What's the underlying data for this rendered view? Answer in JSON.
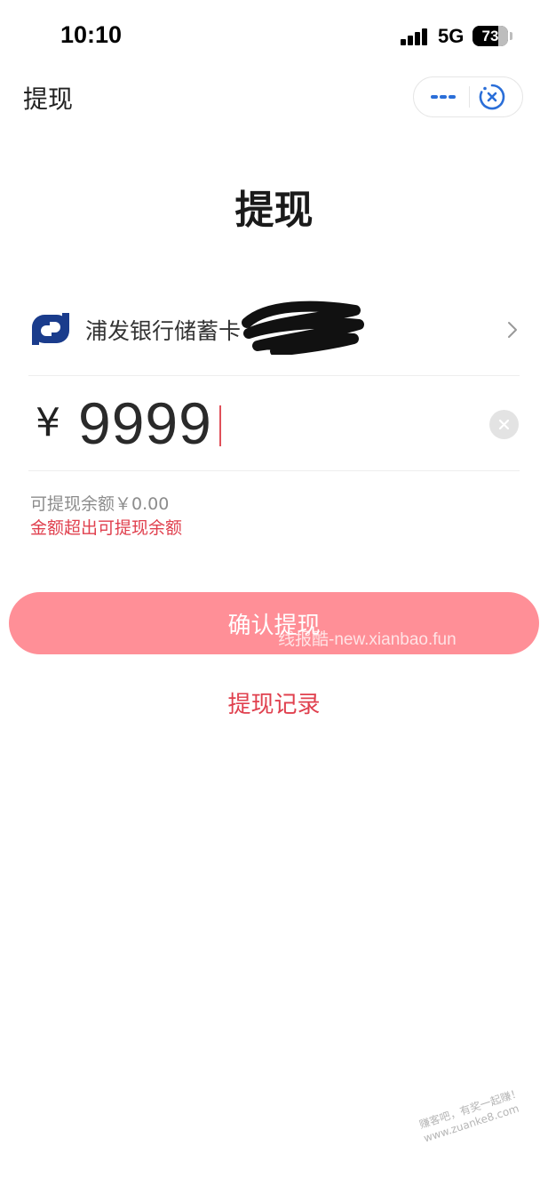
{
  "status_bar": {
    "time": "10:10",
    "network": "5G",
    "battery": "73",
    "battery_level": 0.73
  },
  "nav": {
    "title": "提现",
    "more_icon": "more-dots-icon",
    "close_icon": "close-circle-icon"
  },
  "heading": "提现",
  "bank": {
    "name": "浦发银行储蓄卡",
    "logo_icon": "spdb-logo",
    "logo_color": "#1a3c8c",
    "chevron_icon": "chevron-right-icon"
  },
  "amount": {
    "currency": "¥",
    "value": "9999",
    "clear_icon": "clear-icon"
  },
  "balance_text": "可提现余额￥0.00",
  "error_text": "金额超出可提现余额",
  "confirm_label": "确认提现",
  "records_label": "提现记录",
  "watermark": "线报酷-new.xianbao.fun",
  "corner_watermark": {
    "line1": "赚客吧，有奖一起赚！",
    "line2": "www.zuanke8.com"
  },
  "colors": {
    "accent": "#e0404e",
    "button_bg": "#ff8f97",
    "link_blue": "#2a6ed8"
  }
}
